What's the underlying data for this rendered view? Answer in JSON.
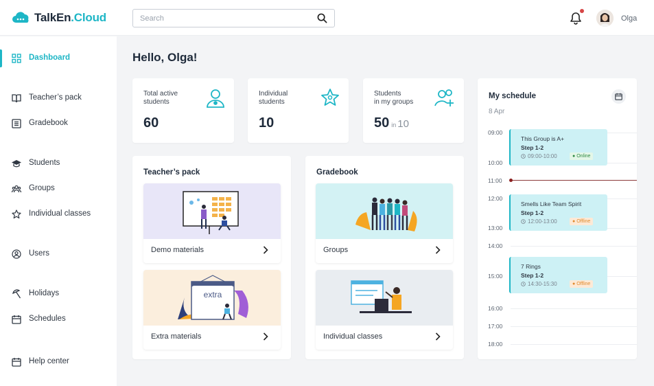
{
  "app": {
    "logo_prefix": "TalkEn",
    "logo_accent": ".Cloud",
    "accent_color": "#1eb6c6"
  },
  "header": {
    "search_placeholder": "Search",
    "user_name": "Olga"
  },
  "sidebar": {
    "items": [
      {
        "label": "Dashboard",
        "icon": "grid-icon"
      },
      {
        "label": "Teacher’s pack",
        "icon": "book-icon"
      },
      {
        "label": "Gradebook",
        "icon": "list-icon"
      },
      {
        "label": "Students",
        "icon": "graduation-cap-icon"
      },
      {
        "label": "Groups",
        "icon": "people-icon"
      },
      {
        "label": "Individual classes",
        "icon": "star-icon"
      },
      {
        "label": "Users",
        "icon": "user-circle-icon"
      },
      {
        "label": "Holidays",
        "icon": "beach-umbrella-icon"
      },
      {
        "label": "Schedules",
        "icon": "calendar-icon"
      },
      {
        "label": "Help center",
        "icon": "calendar-help-icon"
      }
    ]
  },
  "main": {
    "greeting": "Hello, Olga!",
    "stats": [
      {
        "label": "Total active\nstudents",
        "value": "60",
        "icon": "students-icon"
      },
      {
        "label": "Individual\nstudents",
        "value": "10",
        "icon": "star-user-icon"
      },
      {
        "label": "Students\nin my groups",
        "value": "50",
        "in_text": "in",
        "total": "10",
        "icon": "add-group-icon"
      }
    ],
    "teachers_pack": {
      "title": "Teacher’s pack",
      "tiles": [
        {
          "label": "Demo materials",
          "bg": "#e8e6f8"
        },
        {
          "label": "Extra materials",
          "bg": "#fbeedd",
          "illustration_text": "extra"
        }
      ]
    },
    "gradebook": {
      "title": "Gradebook",
      "tiles": [
        {
          "label": "Groups",
          "bg": "#d3f2f4"
        },
        {
          "label": "Individual classes",
          "bg": "#e9edf1"
        }
      ]
    }
  },
  "schedule": {
    "title": "My schedule",
    "date": "8 Apr",
    "hours": [
      "09:00",
      "10:00",
      "11:00",
      "12:00",
      "13:00",
      "14:00",
      "15:00",
      "16:00",
      "17:00",
      "18:00"
    ],
    "events": [
      {
        "name": "This Group is A+",
        "step": "Step 1-2",
        "time": "09:00-10:00",
        "status": "Online"
      },
      {
        "name": "Smells Like Team Spirit",
        "step": "Step 1-2",
        "time": "12:00-13:00",
        "status": "Offline"
      },
      {
        "name": "7 Rings",
        "step": "Step 1-2",
        "time": "14:30-15:30",
        "status": "Offline"
      }
    ]
  }
}
